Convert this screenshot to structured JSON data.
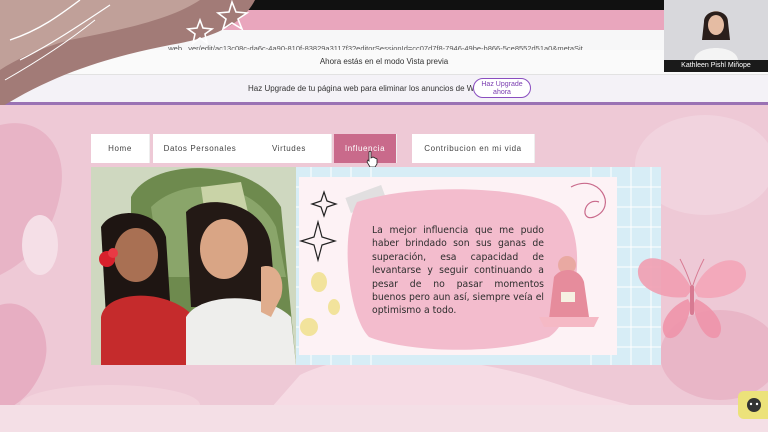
{
  "browser": {
    "url": "...web...ver/edit/ac13c08c-da6c-4a90-810f-83829a3117f3?editorSessionId=cc07d7f8-7946-49be-b866-5ce8552d51a0&metaSit...",
    "preview_notice": "Ahora estás en el modo Vista previa"
  },
  "upgrade_banner": {
    "text": "Haz Upgrade de tu página web para eliminar los anuncios de Wix",
    "button_label": "Haz Upgrade ahora"
  },
  "webcam": {
    "participant_name": "Kathleen Pishl Miñope"
  },
  "site": {
    "nav": [
      {
        "label": "Home"
      },
      {
        "label": "Datos Personales"
      },
      {
        "label": "Virtudes"
      },
      {
        "label": "Influencia"
      },
      {
        "label": "Contribucion en mi vida"
      }
    ],
    "quote": "La mejor influencia que me pudo haber brindado son sus ganas de superación, esa capacidad de levantarse y seguir continuando a pesar de no pasar momentos buenos pero aun así, siempre veía el optimismo a todo."
  },
  "colors": {
    "nav_active": "#c96a8b",
    "banner_accent": "#9a72b4",
    "site_background": "#eec9d6"
  }
}
